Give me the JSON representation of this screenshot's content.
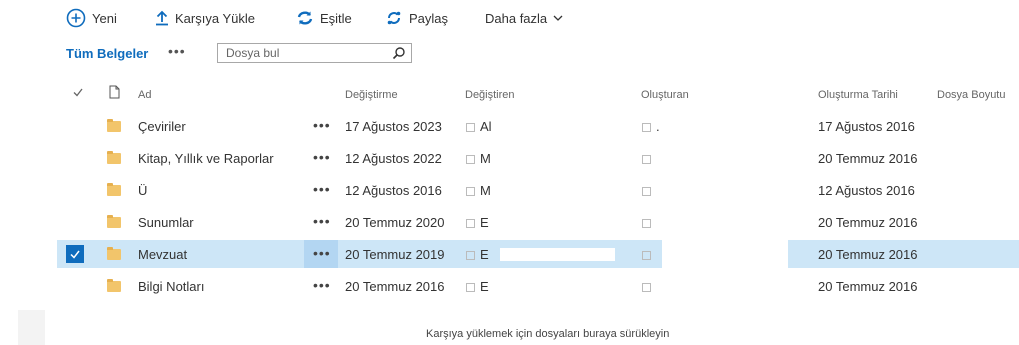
{
  "commands": {
    "new_label": "Yeni",
    "upload_label": "Karşıya Yükle",
    "sync_label": "Eşitle",
    "share_label": "Paylaş",
    "more_label": "Daha fazla"
  },
  "view": {
    "label": "Tüm Belgeler",
    "more": "•••",
    "search_placeholder": "Dosya bul"
  },
  "columns": {
    "name": "Ad",
    "modified": "Değiştirme",
    "modified_by": "Değiştiren",
    "created_by": "Oluşturan",
    "created": "Oluşturma Tarihi",
    "size": "Dosya Boyutu"
  },
  "rows": [
    {
      "name": "Çeviriler",
      "modified": "17 Ağustos 2023",
      "modified_by": "Al",
      "created_by": ".",
      "created": "17 Ağustos 2016",
      "selected": false
    },
    {
      "name": "Kitap, Yıllık ve Raporlar",
      "modified": "12 Ağustos 2022",
      "modified_by": "M",
      "created_by": "",
      "created": "20 Temmuz 2016",
      "selected": false
    },
    {
      "name": "Ü",
      "modified": "12 Ağustos 2016",
      "modified_by": "M",
      "created_by": "",
      "created": "12 Ağustos 2016",
      "selected": false
    },
    {
      "name": "Sunumlar",
      "modified": "20 Temmuz 2020",
      "modified_by": "E",
      "created_by": "",
      "created": "20 Temmuz 2016",
      "selected": false
    },
    {
      "name": "Mevzuat",
      "modified": "20 Temmuz 2019",
      "modified_by": "E",
      "created_by": "",
      "created": "20 Temmuz 2016",
      "selected": true
    },
    {
      "name": "Bilgi Notları",
      "modified": "20 Temmuz 2016",
      "modified_by": "E",
      "created_by": "",
      "created": "20 Temmuz 2016",
      "selected": false
    }
  ],
  "row_more": "•••",
  "drop_hint": "Karşıya yüklemek için dosyaları buraya sürükleyin",
  "colors": {
    "accent": "#0f6cbd",
    "selection": "#cde6f7",
    "folder": "#f2c56b"
  },
  "icons": [
    "add-circle-icon",
    "upload-arrow-icon",
    "sync-icon",
    "share-icon",
    "chevron-down-icon",
    "search-icon",
    "check-icon",
    "document-icon",
    "folder-icon"
  ]
}
